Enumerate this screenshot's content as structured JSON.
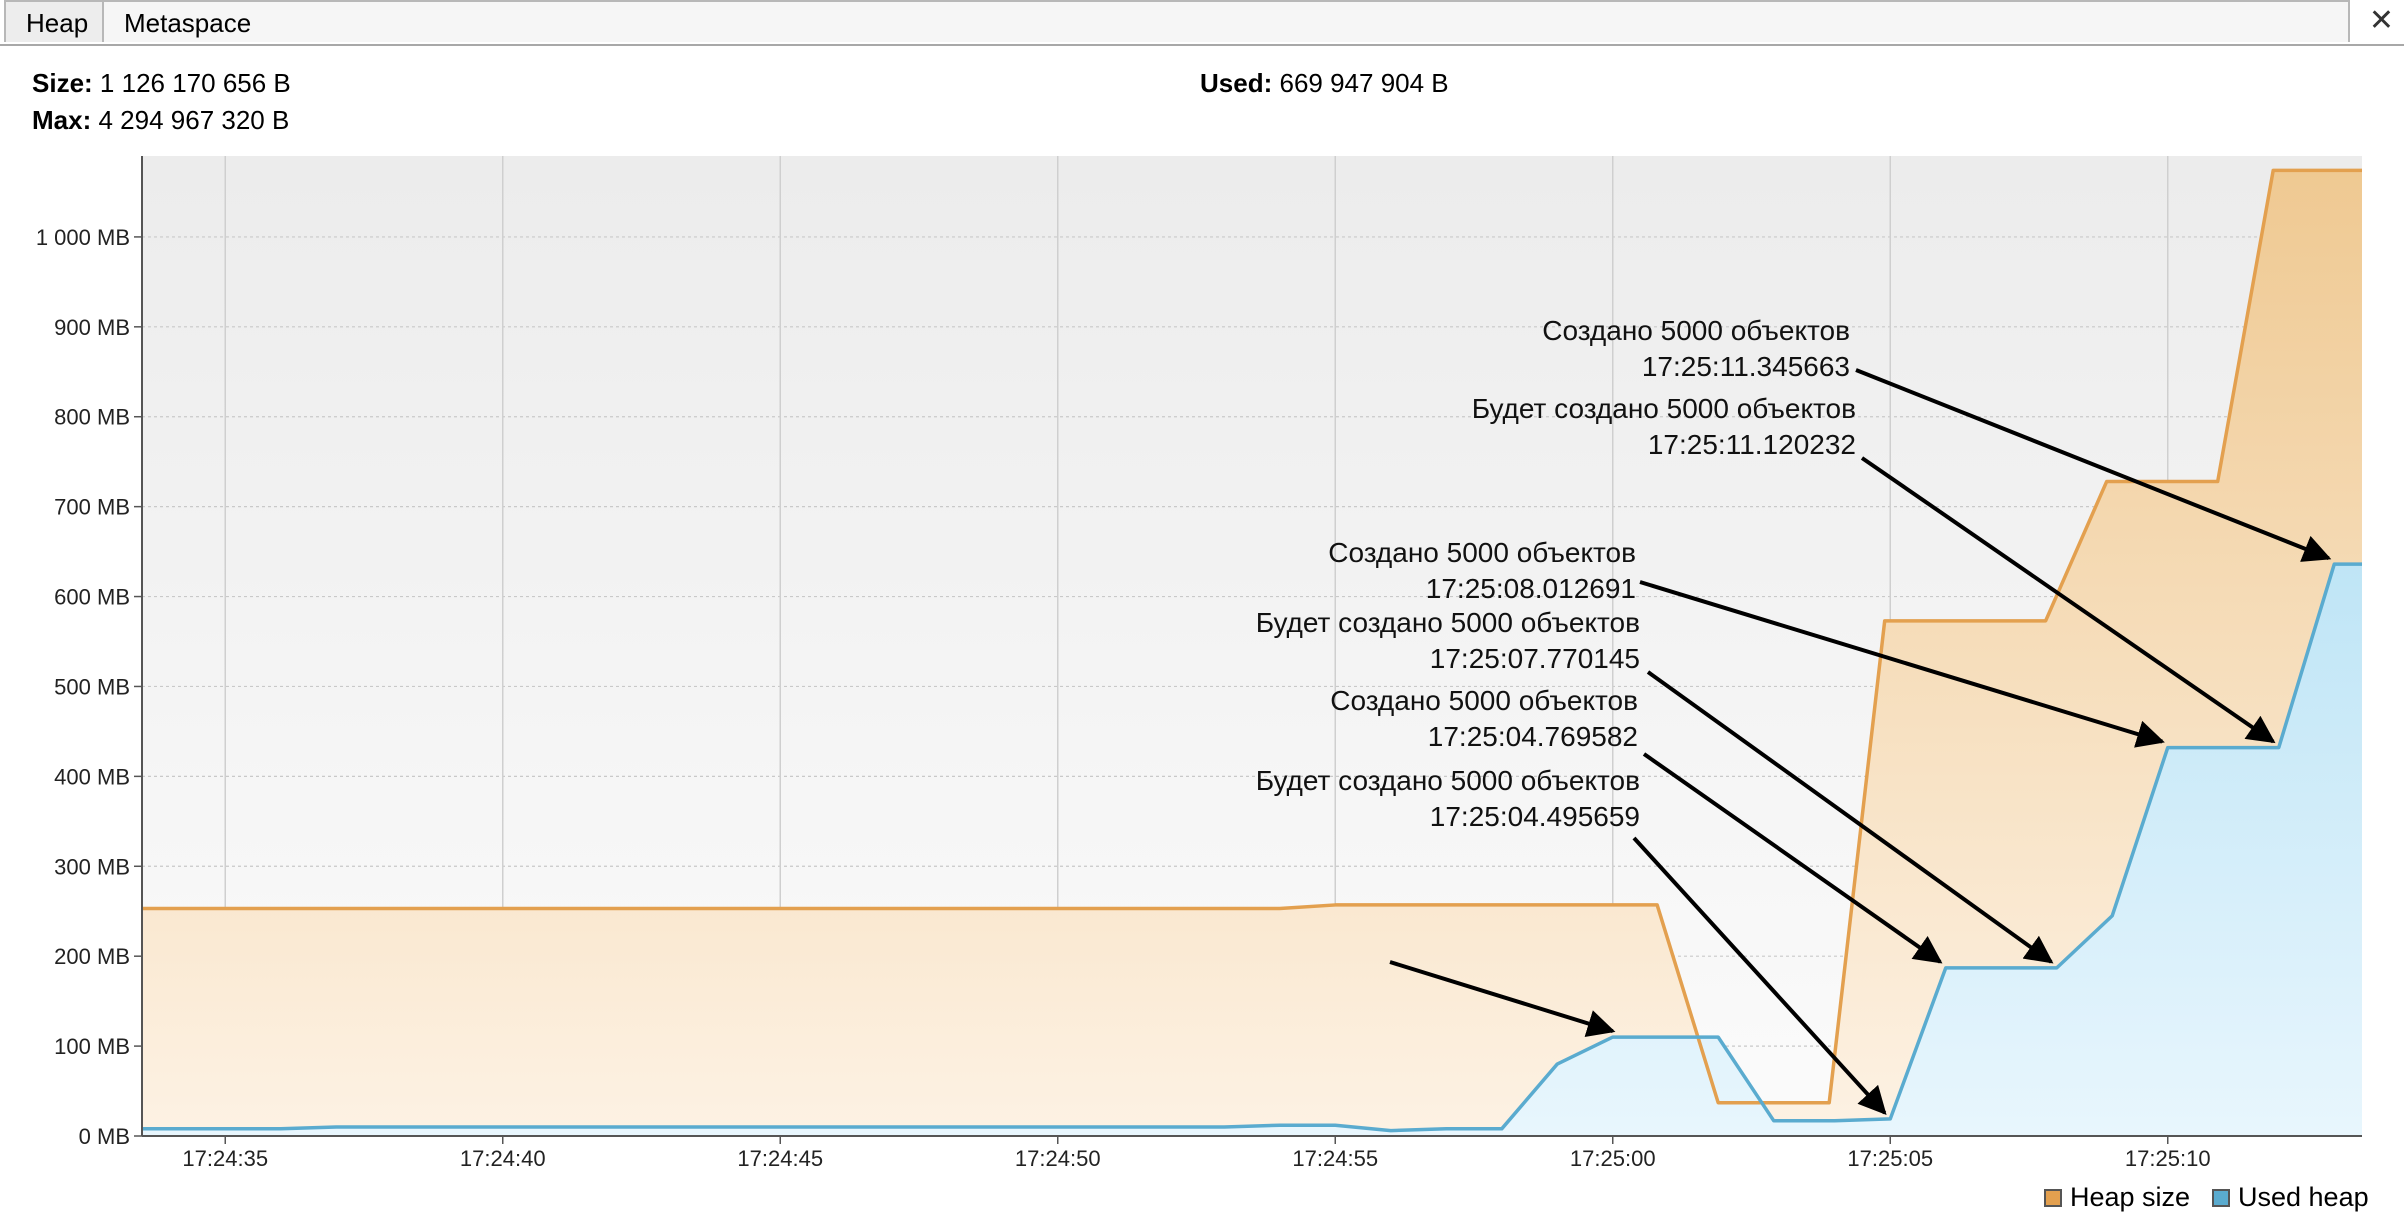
{
  "tabs": [
    {
      "label": "Heap",
      "active": true
    },
    {
      "label": "Metaspace",
      "active": false
    }
  ],
  "close_icon": "close-icon",
  "stats": {
    "size_label": "Size:",
    "size_value": "1 126 170 656 B",
    "max_label": "Max:",
    "max_value": "4 294 967 320 B",
    "used_label": "Used:",
    "used_value": "669 947 904 B"
  },
  "colors": {
    "heap_size": "#e3a04f",
    "used_heap": "#5aabcf",
    "heap_fill": "#f7ddbc",
    "used_fill": "#ccebf8"
  },
  "chart_data": {
    "type": "area",
    "x_axis": {
      "range_seconds": [
        33.5,
        73.5
      ],
      "ticks": [
        {
          "t": 35,
          "label": "17:24:35"
        },
        {
          "t": 40,
          "label": "17:24:40"
        },
        {
          "t": 45,
          "label": "17:24:45"
        },
        {
          "t": 50,
          "label": "17:24:50"
        },
        {
          "t": 55,
          "label": "17:24:55"
        },
        {
          "t": 60,
          "label": "17:25:00"
        },
        {
          "t": 65,
          "label": "17:25:05"
        },
        {
          "t": 70,
          "label": "17:25:10"
        }
      ]
    },
    "y_axis": {
      "range": [
        0,
        1090
      ],
      "ticks": [
        {
          "v": 0,
          "label": "0 MB"
        },
        {
          "v": 100,
          "label": "100 MB"
        },
        {
          "v": 200,
          "label": "200 MB"
        },
        {
          "v": 300,
          "label": "300 MB"
        },
        {
          "v": 400,
          "label": "400 MB"
        },
        {
          "v": 500,
          "label": "500 MB"
        },
        {
          "v": 600,
          "label": "600 MB"
        },
        {
          "v": 700,
          "label": "700 MB"
        },
        {
          "v": 800,
          "label": "800 MB"
        },
        {
          "v": 900,
          "label": "900 MB"
        },
        {
          "v": 1000,
          "label": "1 000 MB"
        }
      ]
    },
    "grid": true,
    "legend_position": "bottom-right",
    "series": [
      {
        "name": "Heap size",
        "points": [
          [
            33.5,
            253
          ],
          [
            54.0,
            253
          ],
          [
            55.0,
            257
          ],
          [
            60.8,
            257
          ],
          [
            61.9,
            37
          ],
          [
            63.9,
            37
          ],
          [
            64.9,
            573
          ],
          [
            67.8,
            573
          ],
          [
            68.9,
            728
          ],
          [
            70.9,
            728
          ],
          [
            71.9,
            1074
          ],
          [
            73.5,
            1074
          ]
        ]
      },
      {
        "name": "Used heap",
        "points": [
          [
            33.5,
            8
          ],
          [
            36.0,
            8
          ],
          [
            37.0,
            10
          ],
          [
            53.0,
            10
          ],
          [
            54.0,
            12
          ],
          [
            55.0,
            12
          ],
          [
            56.0,
            6
          ],
          [
            57.0,
            8
          ],
          [
            58.0,
            8
          ],
          [
            59.0,
            80
          ],
          [
            60.0,
            110
          ],
          [
            61.9,
            110
          ],
          [
            62.9,
            17
          ],
          [
            64.0,
            17
          ],
          [
            65.0,
            19
          ],
          [
            66.0,
            187
          ],
          [
            68.0,
            187
          ],
          [
            69.0,
            245
          ],
          [
            70.0,
            432
          ],
          [
            72.0,
            432
          ],
          [
            73.0,
            636
          ],
          [
            73.5,
            636
          ]
        ]
      }
    ],
    "annotations": [
      {
        "line1": "Создано 5000 объектов",
        "line2": "17:25:11.345663",
        "target": [
          72.9,
          636
        ]
      },
      {
        "line1": "Будет создано 5000 объектов",
        "line2": "17:25:11.120232",
        "target": [
          71.9,
          432
        ]
      },
      {
        "line1": "Создано 5000 объектов",
        "line2": "17:25:08.012691",
        "target": [
          69.9,
          432
        ]
      },
      {
        "line1": "Будет создано 5000 объектов",
        "line2": "17:25:07.770145",
        "target": [
          67.9,
          187
        ]
      },
      {
        "line1": "Создано 5000 объектов",
        "line2": "17:25:04.769582",
        "target": [
          65.9,
          187
        ]
      },
      {
        "line1": "Будет создано 5000 объектов",
        "line2": "17:25:04.495659",
        "target": [
          64.9,
          19
        ]
      },
      {
        "line1": "",
        "line2": "",
        "target": [
          60.0,
          110
        ]
      }
    ]
  },
  "legend": [
    {
      "label": "Heap size",
      "color": "#e3a04f"
    },
    {
      "label": "Used heap",
      "color": "#5aabcf"
    }
  ]
}
